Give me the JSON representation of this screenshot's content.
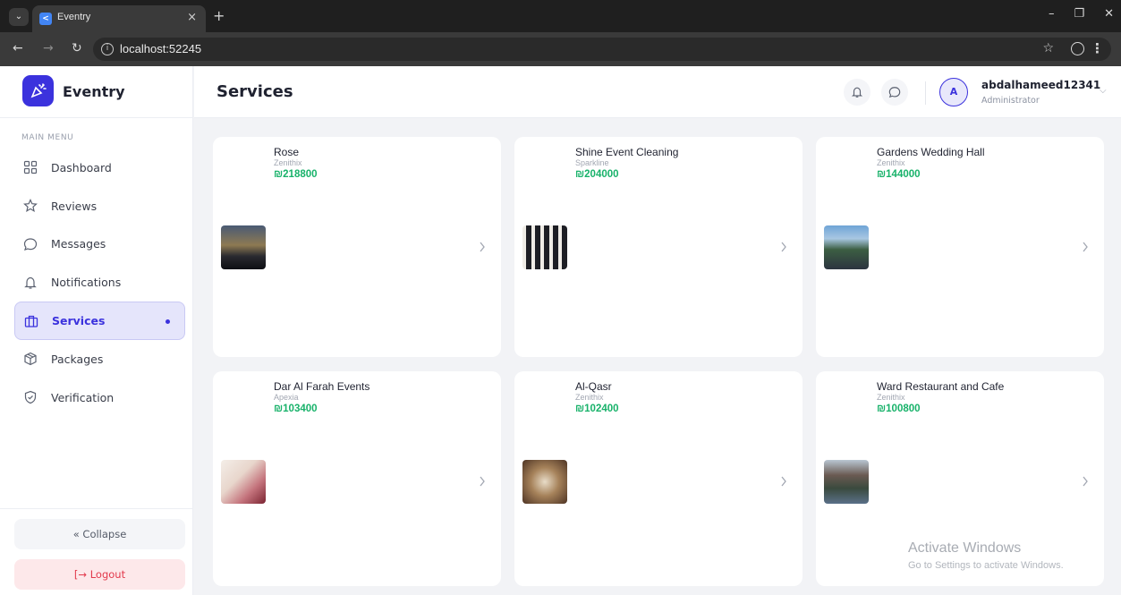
{
  "browser": {
    "tab_title": "Eventry",
    "tab_close": "×",
    "new_tab": "+",
    "url": "localhost:52245"
  },
  "sidebar": {
    "brand_name": "Eventry",
    "menu_heading": "MAIN MENU",
    "items": [
      {
        "label": "Dashboard",
        "icon": "dashboard-icon"
      },
      {
        "label": "Reviews",
        "icon": "star-icon"
      },
      {
        "label": "Messages",
        "icon": "chat-icon"
      },
      {
        "label": "Notifications",
        "icon": "bell-icon"
      },
      {
        "label": "Services",
        "icon": "briefcase-icon",
        "active": true
      },
      {
        "label": "Packages",
        "icon": "package-icon"
      },
      {
        "label": "Verification",
        "icon": "shield-check-icon"
      }
    ],
    "collapse_label": "« Collapse",
    "logout_label": "[→ Logout"
  },
  "header": {
    "title": "Services",
    "user": {
      "initial": "A",
      "name": "abdalhameed12341",
      "role": "Administrator"
    }
  },
  "services": [
    {
      "name": "Rose",
      "vendor": "Zenithix",
      "price": "₪218800"
    },
    {
      "name": "Shine Event Cleaning",
      "vendor": "Sparkline",
      "price": "₪204000"
    },
    {
      "name": "Gardens Wedding Hall",
      "vendor": "Zenithix",
      "price": "₪144000"
    },
    {
      "name": "Dar Al Farah Events",
      "vendor": "Apexia",
      "price": "₪103400"
    },
    {
      "name": "Al-Qasr",
      "vendor": "Zenithix",
      "price": "₪102400"
    },
    {
      "name": "Ward Restaurant and Cafe",
      "vendor": "Zenithix",
      "price": "₪100800"
    }
  ],
  "watermark": {
    "title": "Activate Windows",
    "subtitle": "Go to Settings to activate Windows."
  },
  "colors": {
    "accent": "#3b32dd",
    "price": "#18b26a",
    "logout": "#e2394c"
  }
}
